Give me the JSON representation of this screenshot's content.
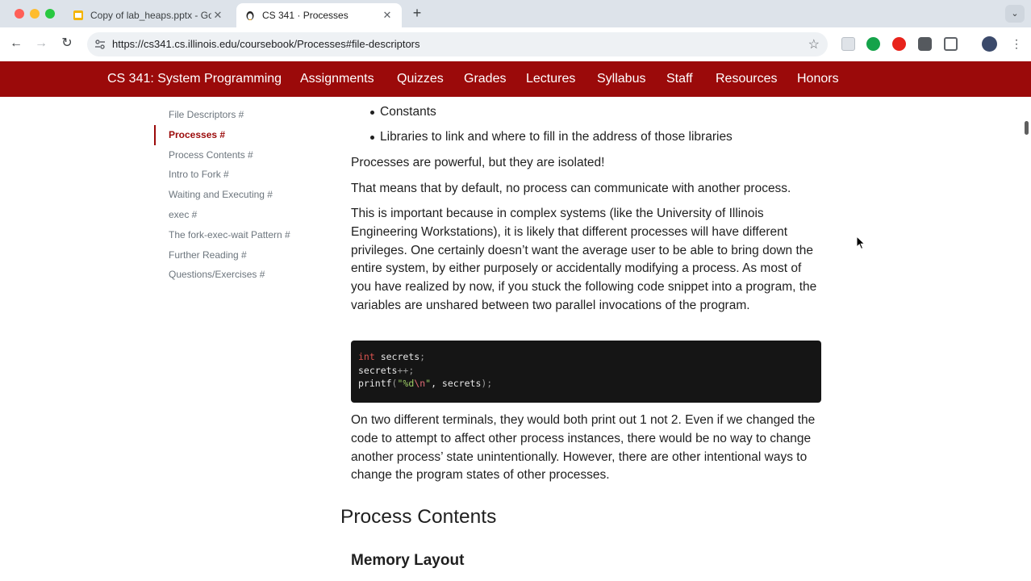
{
  "browser": {
    "tabs": [
      {
        "title": "Copy of lab_heaps.pptx - Goo",
        "active": false
      },
      {
        "title": "CS 341 · Processes",
        "active": true
      }
    ],
    "new_tab_symbol": "+",
    "url": "https://cs341.cs.illinois.edu/coursebook/Processes#file-descriptors"
  },
  "site_nav": {
    "brand": "CS 341: System Programming",
    "links": [
      "Assignments",
      "Quizzes",
      "Grades",
      "Lectures",
      "Syllabus",
      "Staff",
      "Resources",
      "Honors"
    ],
    "color": "#9b0a0a"
  },
  "toc": [
    {
      "label": "File Descriptors #",
      "active": false
    },
    {
      "label": "Processes #",
      "active": true
    },
    {
      "label": "Process Contents #",
      "active": false
    },
    {
      "label": "Intro to Fork #",
      "active": false
    },
    {
      "label": "Waiting and Executing #",
      "active": false
    },
    {
      "label": "exec #",
      "active": false
    },
    {
      "label": "The fork-exec-wait Pattern #",
      "active": false
    },
    {
      "label": "Further Reading #",
      "active": false
    },
    {
      "label": "Questions/Exercises #",
      "active": false
    }
  ],
  "article": {
    "bullets": [
      "Constants",
      "Libraries to link and where to fill in the address of those libraries"
    ],
    "paragraphs": [
      "Processes are powerful, but they are isolated!",
      "That means that by default, no process can communicate with another process.",
      "This is important because in complex systems (like the University of Illinois Engineering Workstations), it is likely that different processes will have different privileges. One certainly doesn’t want the average user to be able to bring down the entire system, by either purposely or accidentally modifying a process. As most of you have realized by now, if you stuck the following code snippet into a program, the variables are unshared between two parallel invocations of the program.",
      "On two different terminals, they would both print out 1 not 2. Even if we changed the code to attempt to affect other process instances, there would be no way to change another process’ state unintentionally. However, there are other intentional ways to change the program states of other processes."
    ],
    "code": {
      "line1_keyword": "int",
      "line1_rest": " secrets",
      "line1_punc": ";",
      "line2_ident": "secrets",
      "line2_punc": "++;",
      "line3_func": "printf",
      "line3_open": "(",
      "line3_str_a": "\"%d",
      "line3_esc": "\\n",
      "line3_str_b": "\"",
      "line3_args": ", secrets",
      "line3_close": ");"
    },
    "section_heading": "Process Contents",
    "subsection_heading": "Memory Layout"
  }
}
